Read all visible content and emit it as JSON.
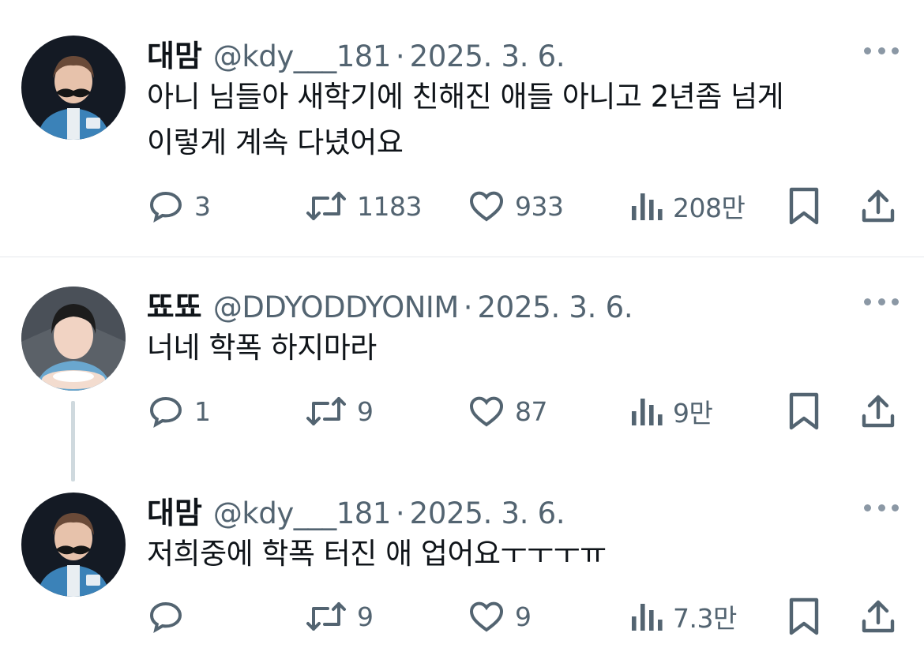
{
  "tweets": [
    {
      "name": "대맘",
      "handle": "@kdy___181",
      "separator": "·",
      "date": "2025. 3. 6.",
      "text_lines": [
        "아니 님들아 새학기에 친해진 애들 아니고 2년좀 넘게",
        "이렇게 계속 다녔어요"
      ],
      "replies": "3",
      "retweets": "1183",
      "likes": "933",
      "views": "208만"
    },
    {
      "name": "뚀뚀",
      "handle": "@DDYODDYONIM",
      "separator": "·",
      "date": "2025. 3. 6.",
      "text_lines": [
        "너네 학폭 하지마라"
      ],
      "replies": "1",
      "retweets": "9",
      "likes": "87",
      "views": "9만"
    },
    {
      "name": "대맘",
      "handle": "@kdy___181",
      "separator": "·",
      "date": "2025. 3. 6.",
      "text_lines": [
        "저희중에 학폭 터진 애 업어요ㅜㅜㅜㅠ"
      ],
      "replies": "",
      "retweets": "9",
      "likes": "9",
      "views": "7.3만"
    }
  ],
  "colors": {
    "text_primary": "#0f1419",
    "text_secondary": "#536471",
    "divider": "#e5e9ec",
    "thread_line": "#cfd9de"
  },
  "icons": [
    "reply-icon",
    "retweet-icon",
    "like-icon",
    "views-icon",
    "bookmark-icon",
    "share-icon",
    "more-icon"
  ]
}
